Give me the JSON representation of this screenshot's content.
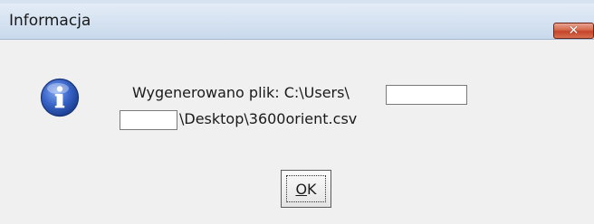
{
  "window": {
    "title": "Informacja",
    "close_glyph": "✕"
  },
  "message": {
    "line1": "Wygenerowano plik: C:\\Users\\",
    "line2": "\\Desktop\\3600orient.csv",
    "icon": "info-icon"
  },
  "ok_button": {
    "accel": "O",
    "rest": "K"
  },
  "colors": {
    "titlebar": "#c9d9ec",
    "close_button": "#c4432a",
    "info_icon": "#2f57b8",
    "background": "#f0f0f0"
  }
}
